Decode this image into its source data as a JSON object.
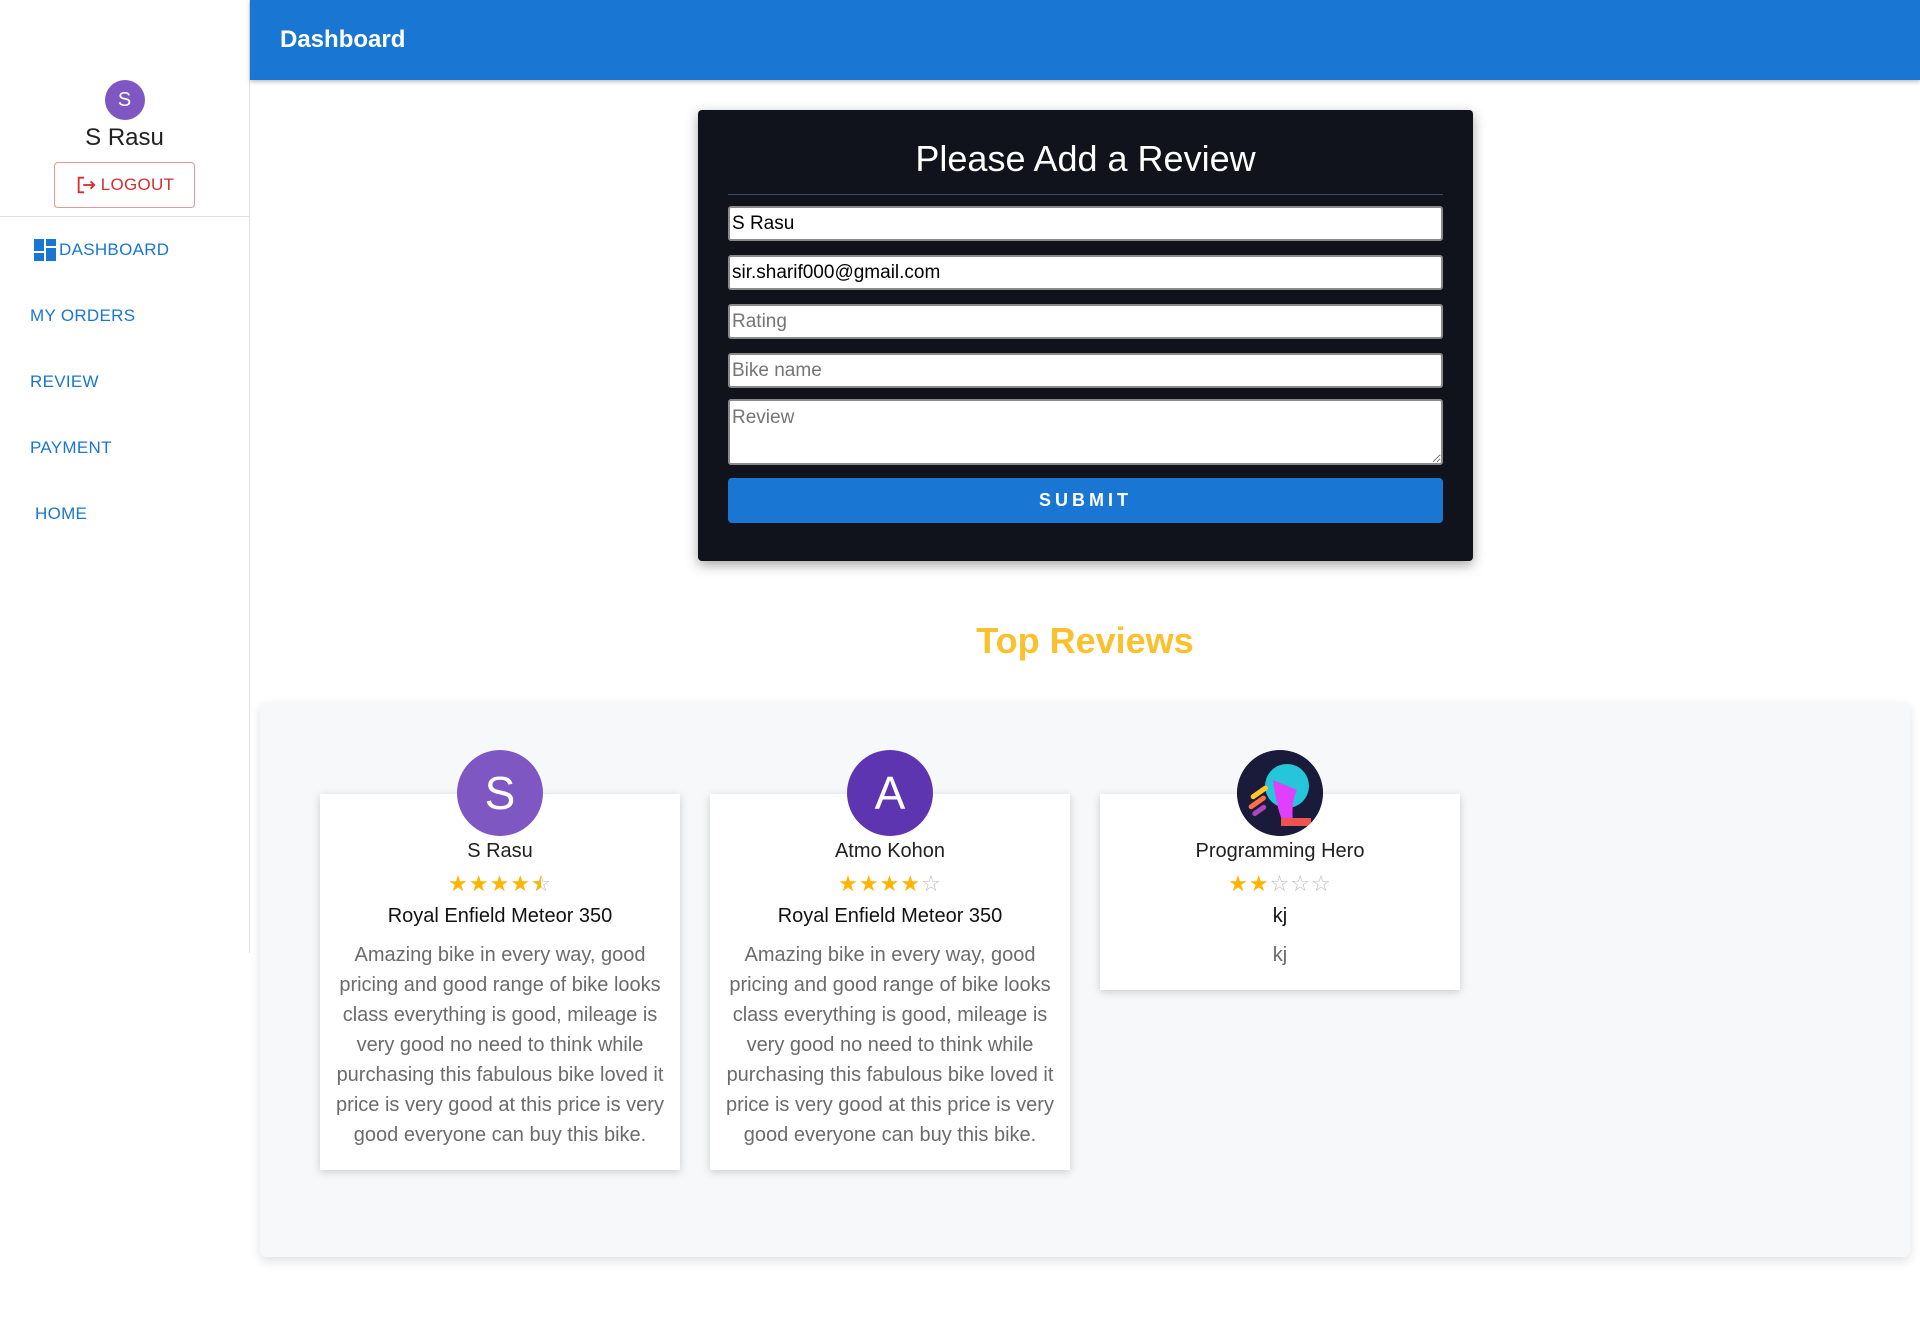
{
  "user": {
    "initial": "S",
    "name": "S Rasu"
  },
  "sidebar": {
    "logout_label": "LOGOUT",
    "items": [
      {
        "label": "DASHBOARD",
        "icon": "dashboard-icon"
      },
      {
        "label": "MY ORDERS"
      },
      {
        "label": "REVIEW"
      },
      {
        "label": "PAYMENT"
      },
      {
        "label": "HOME"
      }
    ]
  },
  "appbar": {
    "title": "Dashboard"
  },
  "form": {
    "title": "Please Add a Review",
    "name_value": "S Rasu",
    "email_value": "sir.sharif000@gmail.com",
    "rating_placeholder": "Rating",
    "bike_placeholder": "Bike name",
    "review_placeholder": "Review",
    "submit_label": "SUBMIT"
  },
  "reviews": {
    "heading": "Top Reviews",
    "items": [
      {
        "avatar_initial": "S",
        "avatar_color": "#7e57c2",
        "name": "S Rasu",
        "rating": 4.5,
        "bike": "Royal Enfield Meteor 350",
        "text": "Amazing bike in every way, good pricing and good range of bike looks class everything is good, mileage is very good no need to think while purchasing this fabulous bike loved it price is very good at this price is very good everyone can buy this bike."
      },
      {
        "avatar_initial": "A",
        "avatar_color": "#5e35b1",
        "name": "Atmo Kohon",
        "rating": 4,
        "bike": "Royal Enfield Meteor 350",
        "text": "Amazing bike in every way, good pricing and good range of bike looks class everything is good, mileage is very good no need to think while purchasing this fabulous bike loved it price is very good at this price is very good everyone can buy this bike."
      },
      {
        "avatar_initial": "",
        "avatar_icon": "programming-hero-logo",
        "name": "Programming Hero",
        "rating": 2,
        "bike": "kj",
        "text": "kj"
      }
    ]
  },
  "colors": {
    "primary": "#1976d2",
    "logout": "#d32f2f",
    "heading": "#fbc02d",
    "star": "#ffb400",
    "form_bg": "#10121c"
  }
}
